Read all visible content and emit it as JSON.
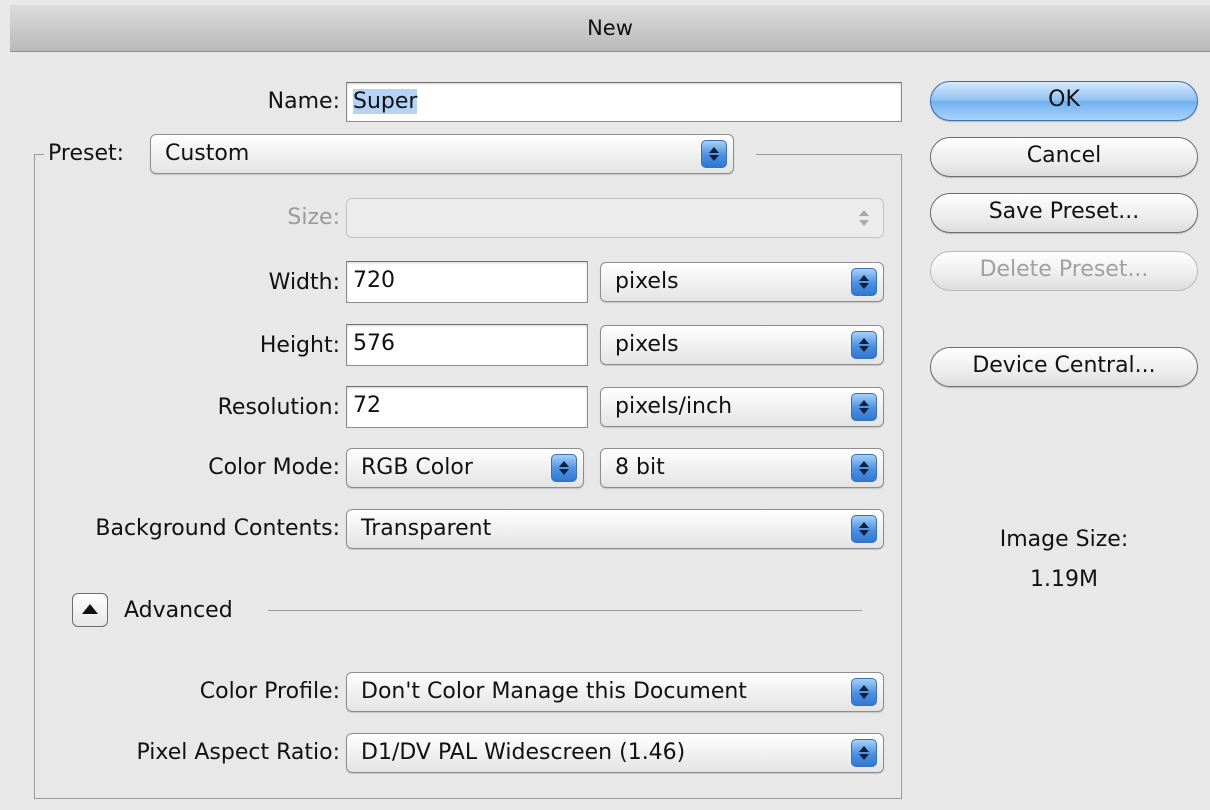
{
  "window": {
    "title": "New"
  },
  "fields": {
    "name": {
      "label": "Name:",
      "value": "Super"
    },
    "preset": {
      "label": "Preset:",
      "value": "Custom"
    },
    "size": {
      "label": "Size:",
      "value": ""
    },
    "width": {
      "label": "Width:",
      "value": "720",
      "unit": "pixels"
    },
    "height": {
      "label": "Height:",
      "value": "576",
      "unit": "pixels"
    },
    "resolution": {
      "label": "Resolution:",
      "value": "72",
      "unit": "pixels/inch"
    },
    "color_mode": {
      "label": "Color Mode:",
      "value": "RGB Color",
      "depth": "8 bit"
    },
    "background": {
      "label": "Background Contents:",
      "value": "Transparent"
    },
    "advanced": {
      "label": "Advanced"
    },
    "color_profile": {
      "label": "Color Profile:",
      "value": "Don't Color Manage this Document"
    },
    "pixel_aspect": {
      "label": "Pixel Aspect Ratio:",
      "value": "D1/DV PAL Widescreen (1.46)"
    }
  },
  "buttons": {
    "ok": "OK",
    "cancel": "Cancel",
    "save_preset": "Save Preset...",
    "delete_preset": "Delete Preset...",
    "device_central": "Device Central..."
  },
  "image_size": {
    "label": "Image Size:",
    "value": "1.19M"
  },
  "colors": {
    "accent": "#4a90e2",
    "selection": "#b5d3f6",
    "background": "#e8e8e8"
  }
}
